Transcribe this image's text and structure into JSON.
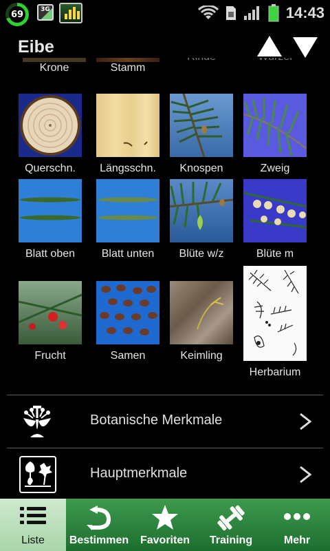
{
  "status_bar": {
    "battery_percent": "69",
    "network": "3G",
    "time": "14:43"
  },
  "header": {
    "title": "Eibe",
    "up_icon": "arrow-up-icon",
    "down_icon": "arrow-down-icon"
  },
  "grid": {
    "partial_row": [
      "Krone",
      "Stamm",
      "Rinde",
      "Wurzel"
    ],
    "rows": [
      [
        "Querschn.",
        "Längsschn.",
        "Knospen",
        "Zweig"
      ],
      [
        "Blatt oben",
        "Blatt unten",
        "Blüte w/z",
        "Blüte m"
      ],
      [
        "Frucht",
        "Samen",
        "Keimling",
        "Herbarium"
      ]
    ]
  },
  "list": [
    {
      "label": "Botanische Merkmale",
      "icon": "flower-diagram-icon"
    },
    {
      "label": "Hauptmerkmale",
      "icon": "leaves-icon"
    }
  ],
  "tabs": [
    {
      "label": "Liste",
      "icon": "list-icon",
      "active": true
    },
    {
      "label": "Bestimmen",
      "icon": "return-arrow-icon",
      "active": false
    },
    {
      "label": "Favoriten",
      "icon": "star-icon",
      "active": false
    },
    {
      "label": "Training",
      "icon": "dumbbell-icon",
      "active": false
    },
    {
      "label": "Mehr",
      "icon": "more-dots-icon",
      "active": false
    }
  ],
  "colors": {
    "tabbar": "#2e8a40",
    "tab_active": "#bfe0bf",
    "sky_blue": "#2f7fd6"
  }
}
